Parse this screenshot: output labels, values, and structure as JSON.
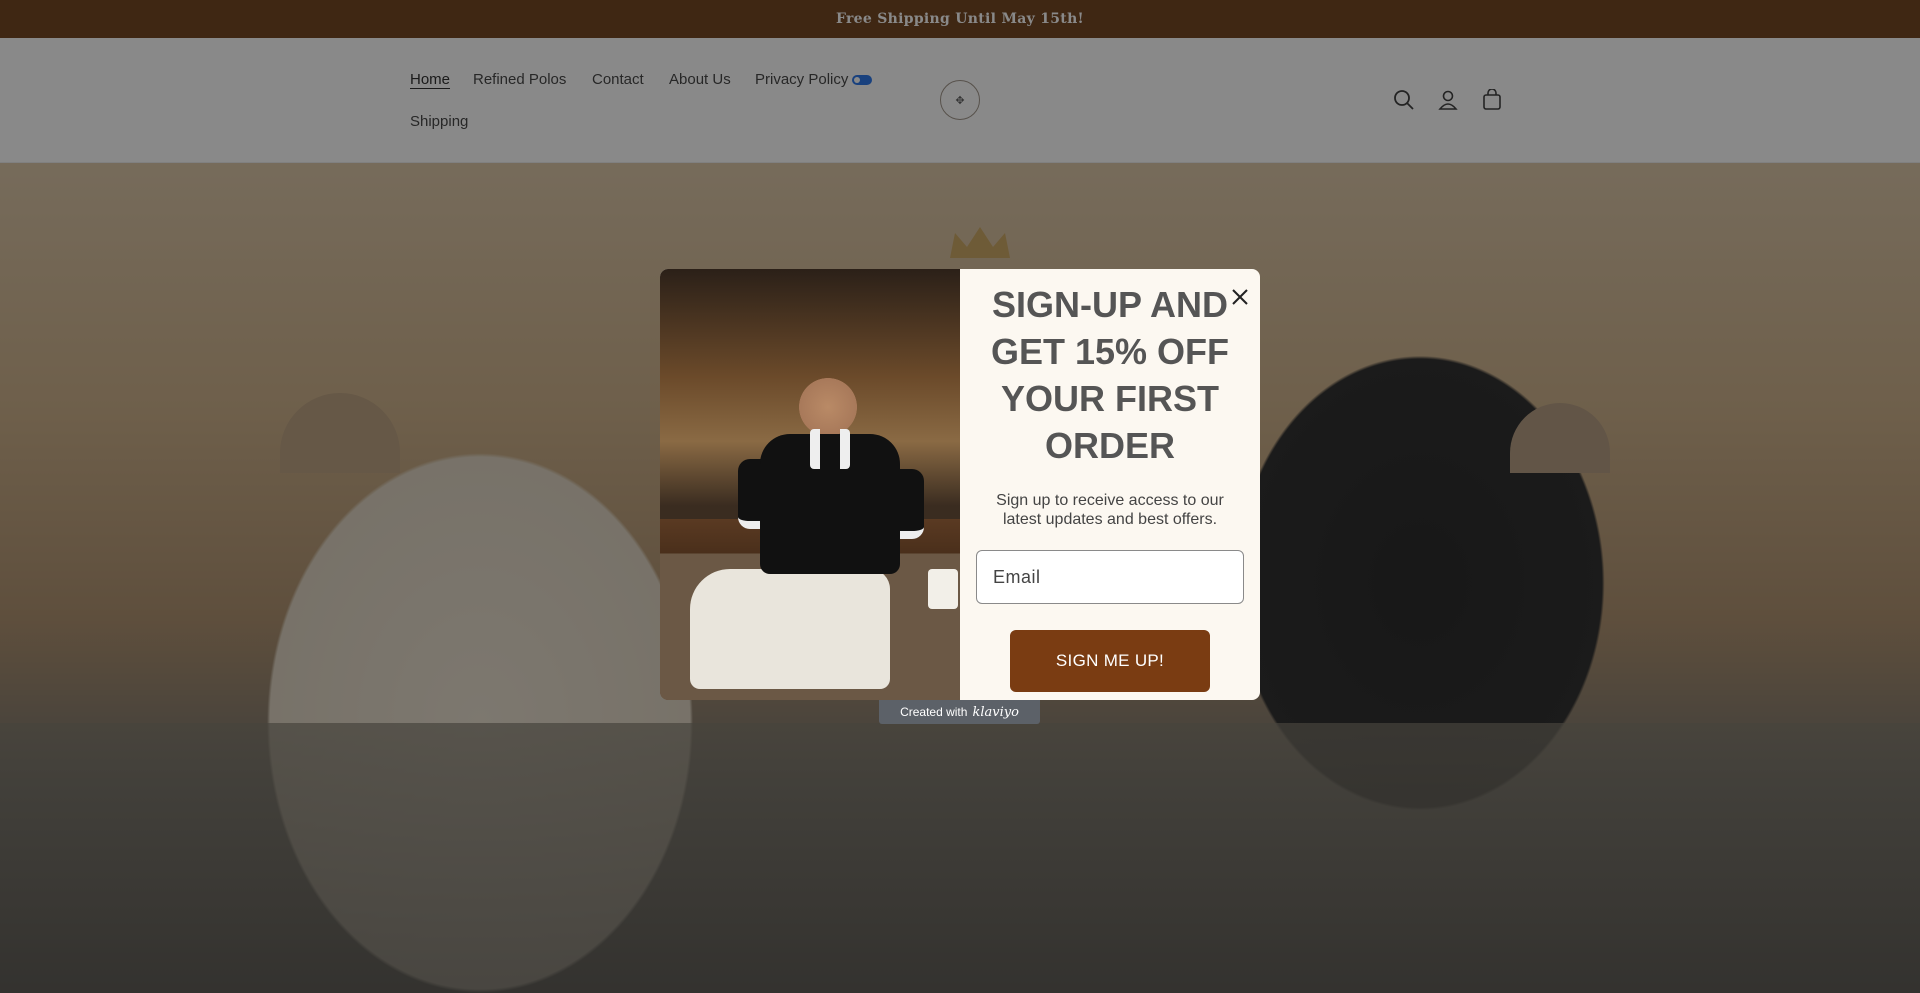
{
  "announcement": {
    "text": "Free Shipping Until May 15th!"
  },
  "nav": {
    "items": [
      {
        "label": "Home",
        "active": true
      },
      {
        "label": "Refined Polos",
        "active": false
      },
      {
        "label": "Contact",
        "active": false
      },
      {
        "label": "About Us",
        "active": false
      },
      {
        "label": "Privacy Policy",
        "active": false,
        "badge": "privacy-choices-icon"
      },
      {
        "label": "Shipping",
        "active": false
      }
    ]
  },
  "header_icons": [
    "search-icon",
    "account-icon",
    "cart-icon"
  ],
  "colors": {
    "announcement_bg": "#6b3a12",
    "button_bg": "#7a3c12",
    "popup_bg": "#fcf8f1",
    "badge_blue": "#1e6ee8"
  },
  "popup": {
    "title": "SIGN-UP AND GET 15% OFF YOUR FIRST ORDER",
    "subtitle": "Sign up to receive access to our latest updates and best offers.",
    "email_placeholder": "Email",
    "submit_label": "SIGN ME UP!",
    "close_icon": "close-icon"
  },
  "klaviyo": {
    "created_with": "Created with",
    "brand": "klaviyo"
  }
}
